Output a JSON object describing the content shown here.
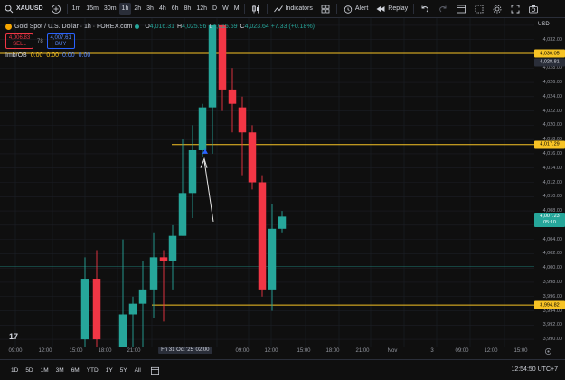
{
  "toolbar": {
    "symbol": "XAUUSD",
    "timeframes": [
      "1m",
      "15m",
      "30m",
      "1h",
      "2h",
      "3h",
      "4h",
      "6h",
      "8h",
      "12h",
      "D",
      "W",
      "M"
    ],
    "active_timeframe": "1h",
    "indicators_label": "Indicators",
    "alert_label": "Alert",
    "replay_label": "Replay"
  },
  "legend": {
    "title": "Gold Spot / U.S. Dollar · 1h · FOREX.com",
    "ohlc": [
      {
        "label": "O",
        "value": "4,016.31"
      },
      {
        "label": "H",
        "value": "4,025.96"
      },
      {
        "label": "L",
        "value": "4,015.59"
      },
      {
        "label": "C",
        "value": "4,023.64 +7.33 (+0.18%)"
      }
    ],
    "sell_price": "4,006.83",
    "sell_label": "SELL",
    "spread": "78",
    "buy_price": "4,007.61",
    "buy_label": "BUY",
    "indicator_name": "Imb/OB",
    "indicator_values": [
      "0.00",
      "0.00",
      "0.00",
      "0.00"
    ]
  },
  "price_axis": {
    "currency": "USD",
    "ticks": [
      "4,034.00",
      "4,032.00",
      "4,028.00",
      "4,026.00",
      "4,024.00",
      "4,022.00",
      "4,020.00",
      "4,018.00",
      "4,016.00",
      "4,014.00",
      "4,012.00",
      "4,010.00",
      "4,008.00",
      "4,006.00",
      "4,004.00",
      "4,002.00",
      "4,000.00",
      "3,998.00",
      "3,996.00",
      "3,994.00",
      "3,992.00",
      "3,990.00"
    ],
    "labels": {
      "level_top": "4,030.05",
      "level_top2": "4,028.81",
      "level_mid": "4,017.29",
      "current_price": "4,007.23",
      "countdown": "05:10",
      "level_bottom": "3,994.82"
    }
  },
  "time_axis": {
    "labels": [
      "09:00",
      "12:00",
      "15:00",
      "18:00",
      "21:00",
      "Fri 31 Oct '25",
      "02:00",
      "09:00",
      "12:00",
      "15:00",
      "18:00",
      "21:00",
      "Nov",
      "3",
      "09:00",
      "12:00",
      "15:00"
    ]
  },
  "bottom": {
    "ranges": [
      "1D",
      "5D",
      "1M",
      "3M",
      "6M",
      "YTD",
      "1Y",
      "5Y",
      "All"
    ],
    "clock": "12:54:50 UTC+7"
  },
  "colors": {
    "up": "#26a69a",
    "down": "#f23645",
    "level_line": "#f7c325",
    "background": "#0f0f0f"
  },
  "chart_data": {
    "type": "candlestick",
    "symbol": "XAUUSD",
    "interval": "1h",
    "candles": [
      {
        "o": 3990.0,
        "h": 4001.5,
        "l": 3988.5,
        "c": 3998.5
      },
      {
        "o": 3998.5,
        "h": 4002.5,
        "l": 3989.0,
        "c": 3990.0
      },
      {
        "o": 3989.0,
        "h": 4004.0,
        "l": 3988.0,
        "c": 3993.5
      },
      {
        "o": 3993.5,
        "h": 3996.0,
        "l": 3987.5,
        "c": 3995.0
      },
      {
        "o": 3995.0,
        "h": 4001.0,
        "l": 3989.0,
        "c": 3997.0
      },
      {
        "o": 3997.0,
        "h": 4005.0,
        "l": 3993.0,
        "c": 4001.5
      },
      {
        "o": 4001.5,
        "h": 4002.5,
        "l": 3992.5,
        "c": 4001.0
      },
      {
        "o": 4001.0,
        "h": 4006.0,
        "l": 3997.0,
        "c": 4004.5
      },
      {
        "o": 4004.5,
        "h": 4018.0,
        "l": 4004.5,
        "c": 4010.5
      },
      {
        "o": 4010.5,
        "h": 4020.0,
        "l": 4007.0,
        "c": 4016.5
      },
      {
        "o": 4016.5,
        "h": 4023.0,
        "l": 4015.5,
        "c": 4022.5
      },
      {
        "o": 4022.5,
        "h": 4033.0,
        "l": 4016.0,
        "c": 4034.0
      },
      {
        "o": 4034.0,
        "h": 4034.0,
        "l": 4022.0,
        "c": 4025.0
      },
      {
        "o": 4025.0,
        "h": 4028.0,
        "l": 4019.0,
        "c": 4023.0
      },
      {
        "o": 4022.5,
        "h": 4024.0,
        "l": 4013.0,
        "c": 4019.0
      },
      {
        "o": 4019.0,
        "h": 4020.0,
        "l": 4011.0,
        "c": 4012.0
      },
      {
        "o": 4012.0,
        "h": 4013.0,
        "l": 3996.0,
        "c": 3997.0
      },
      {
        "o": 3997.0,
        "h": 4009.0,
        "l": 3994.0,
        "c": 4005.5
      },
      {
        "o": 4005.5,
        "h": 4008.0,
        "l": 4005.0,
        "c": 4007.2
      }
    ],
    "levels": [
      4030.05,
      4017.29,
      3994.82
    ],
    "ylim": [
      3989,
      4035
    ]
  }
}
